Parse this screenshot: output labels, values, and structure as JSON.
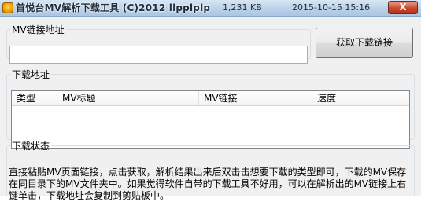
{
  "window": {
    "title": "首悦台MV解析下载工具  (C)2012 llpplplp",
    "file_size": "1,231 KB",
    "datetime": "2015-10-15 15:16",
    "close_label": "X"
  },
  "url_group": {
    "legend": "MV链接地址",
    "input_value": "",
    "fetch_button": "获取下载链接"
  },
  "list_group": {
    "legend": "下载地址",
    "columns": [
      "类型",
      "MV标题",
      "MV链接",
      "速度"
    ]
  },
  "status_group": {
    "legend": "下载状态",
    "lines": [
      "直接粘贴MV页面链接，点击获取，解析结果出来后双击击想要下载的类型即可，下载的MV保存",
      "在同目录下的MV文件夹中。如果觉得软件自带的下载工具不好用，可以在解析出的MV链接上右",
      "键单击，下载地址会复制到剪贴板中。"
    ]
  }
}
